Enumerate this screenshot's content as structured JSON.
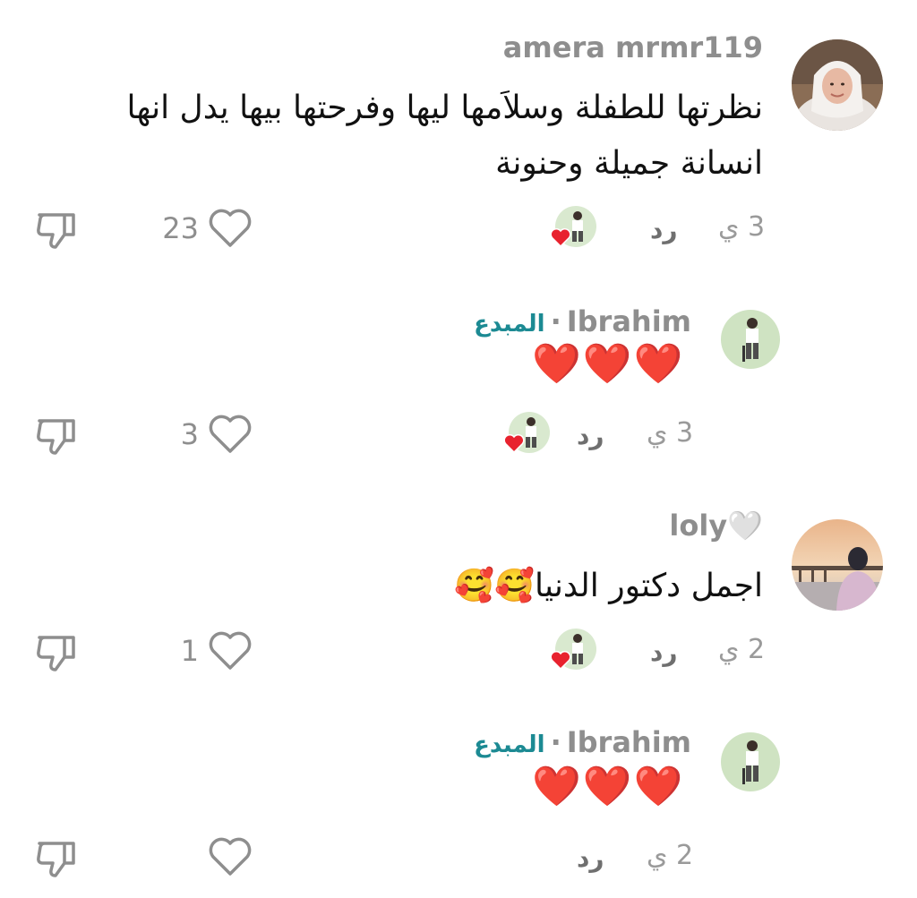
{
  "comments": [
    {
      "username": "amera mrmr119",
      "text": "نظرتها للطفلة وسلاَمها ليها وفرحتها بيها يدل انها انسانة جميلة وحنونة",
      "time": "3 ي",
      "reply_label": "رد",
      "likes": "23",
      "creator_liked": true
    },
    {
      "username": "Ibrahim",
      "separator": "·",
      "creator_tag": "المبدع",
      "text": "❤️❤️❤️",
      "time": "3 ي",
      "reply_label": "رد",
      "likes": "3",
      "creator_liked": true
    },
    {
      "username": "loly🤍",
      "text": "اجمل دكتور الدنيا🥰🥰",
      "time": "2 ي",
      "reply_label": "رد",
      "likes": "1",
      "creator_liked": true
    },
    {
      "username": "Ibrahim",
      "separator": "·",
      "creator_tag": "المبدع",
      "text": "❤️❤️❤️",
      "time": "2 ي",
      "reply_label": "رد",
      "likes": "",
      "creator_liked": false
    }
  ],
  "colors": {
    "creator_tag": "#1c8a93",
    "meta_gray": "#9a9a9a",
    "heart_red": "#e8222e"
  },
  "icons": [
    "heart-outline-icon",
    "dislike-icon",
    "heart-filled-icon"
  ]
}
